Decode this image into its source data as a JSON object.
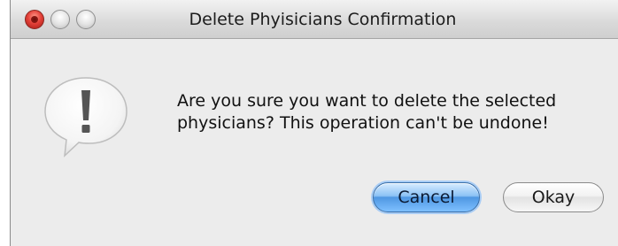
{
  "window": {
    "title": "Delete Phyisicians Confirmation"
  },
  "dialog": {
    "icon": "exclamation-speech-bubble-icon",
    "message_line1": "Are you sure you want to delete the selected",
    "message_line2": "physicians? This operation can't be undone!"
  },
  "buttons": {
    "cancel_label": "Cancel",
    "okay_label": "Okay"
  },
  "colors": {
    "default_button": "#7fb8f0",
    "close_button": "#e5423a"
  }
}
